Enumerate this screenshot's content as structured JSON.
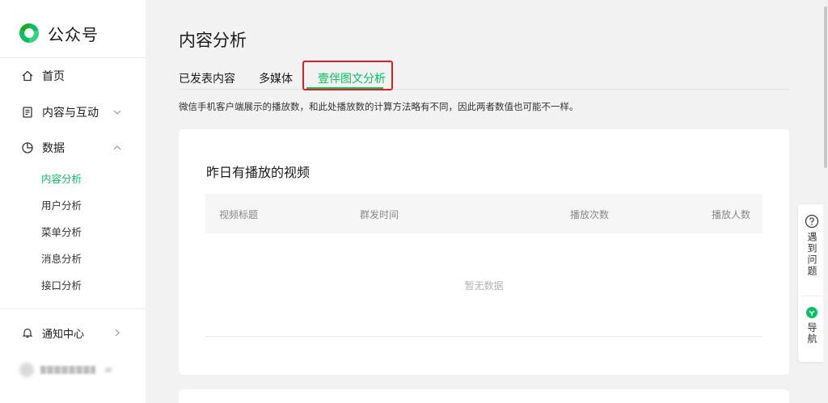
{
  "app": {
    "name": "公众号"
  },
  "sidebar": {
    "items": [
      {
        "label": "首页",
        "icon": "home-icon"
      },
      {
        "label": "内容与互动",
        "icon": "document-icon"
      },
      {
        "label": "数据",
        "icon": "pie-chart-icon"
      }
    ],
    "data_sub": [
      {
        "label": "内容分析",
        "active": true
      },
      {
        "label": "用户分析"
      },
      {
        "label": "菜单分析"
      },
      {
        "label": "消息分析"
      },
      {
        "label": "接口分析"
      }
    ],
    "notice_center": "通知中心"
  },
  "page": {
    "title": "内容分析",
    "tabs": [
      {
        "label": "已发表内容"
      },
      {
        "label": "多媒体"
      },
      {
        "label": "壹伴图文分析",
        "active": true
      }
    ],
    "notice": "微信手机客户端展示的播放数，和此处播放数的计算方法略有不同，因此两者数值也可能不一样。"
  },
  "card": {
    "title": "昨日有播放的视频",
    "columns": [
      "视频标题",
      "群发时间",
      "播放次数",
      "播放人数"
    ],
    "rows": [],
    "empty_text": "暂无数据"
  },
  "float_panel": {
    "help_label": "遇到问题",
    "nav_label": "导航"
  },
  "colors": {
    "accent": "#07c160",
    "highlight": "#e02020"
  }
}
